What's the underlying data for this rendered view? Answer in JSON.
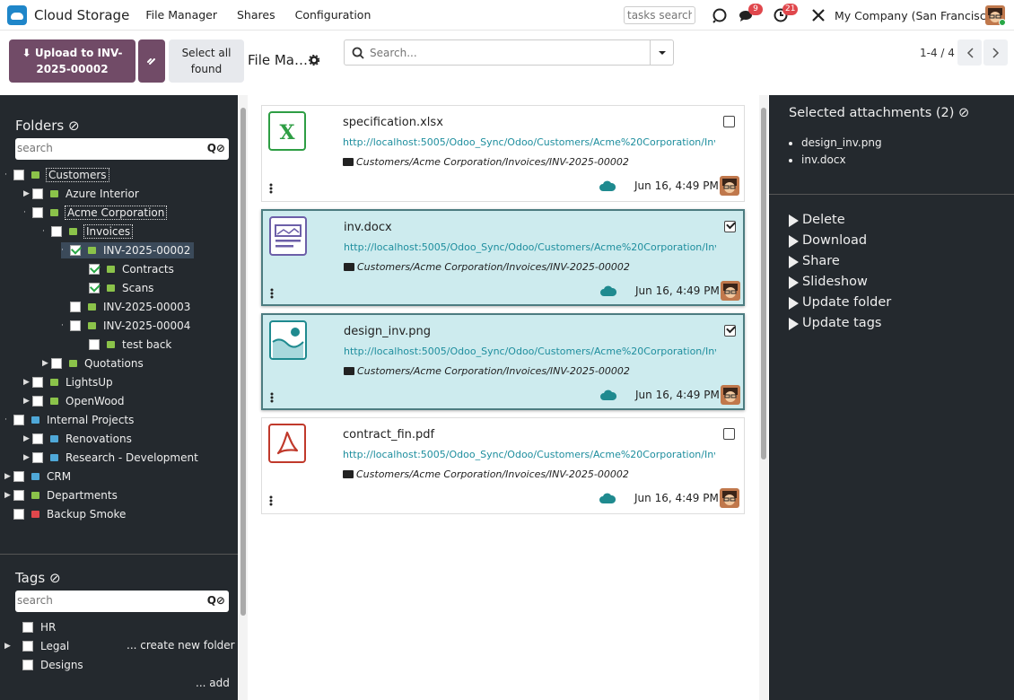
{
  "nav": {
    "brand": "Cloud Storage",
    "menu": [
      "File Manager",
      "Shares",
      "Configuration"
    ],
    "tasks_search_placeholder": "tasks search",
    "messages_badge": "9",
    "activities_badge": "21",
    "company": "My Company (San Francisco)"
  },
  "controls": {
    "upload_label": "Upload to INV-2025-00002",
    "select_all_label": "Select all found",
    "title": "File Ma…",
    "search_placeholder": "Search...",
    "pager": "1-4 / 4"
  },
  "folders": {
    "title": "Folders",
    "search_placeholder": "search",
    "search_icons": "Q⊘",
    "create_label": "... create new folder",
    "items": [
      {
        "label": "Customers"
      },
      {
        "label": "Azure Interior"
      },
      {
        "label": "Acme Corporation"
      },
      {
        "label": "Invoices"
      },
      {
        "label": "INV-2025-00002"
      },
      {
        "label": "Contracts"
      },
      {
        "label": "Scans"
      },
      {
        "label": "INV-2025-00003"
      },
      {
        "label": "INV-2025-00004"
      },
      {
        "label": "test back"
      },
      {
        "label": "Quotations"
      },
      {
        "label": "LightsUp"
      },
      {
        "label": "OpenWood"
      },
      {
        "label": "Internal Projects"
      },
      {
        "label": "Renovations"
      },
      {
        "label": "Research - Development"
      },
      {
        "label": "CRM"
      },
      {
        "label": "Departments"
      },
      {
        "label": "Backup Smoke"
      }
    ]
  },
  "tags": {
    "title": "Tags",
    "search_placeholder": "search",
    "search_icons": "Q⊘",
    "add_label": "... add",
    "items": [
      {
        "label": "HR"
      },
      {
        "label": "Legal"
      },
      {
        "label": "Designs"
      }
    ]
  },
  "attachments": [
    {
      "name": "specification.xlsx",
      "url": "http://localhost:5005/Odoo_Sync/Odoo/Customers/Acme%20Corporation/Invoices/INV-2025-00002/specification.xlsx",
      "path": "Customers/Acme Corporation/Invoices/INV-2025-00002",
      "date": "Jun 16, 4:49 PM",
      "selected": false,
      "icon": "excel-file-icon"
    },
    {
      "name": "inv.docx",
      "url": "http://localhost:5005/Odoo_Sync/Odoo/Customers/Acme%20Corporation/Invoices/INV-2025-00002/inv.docx",
      "path": "Customers/Acme Corporation/Invoices/INV-2025-00002",
      "date": "Jun 16, 4:49 PM",
      "selected": true,
      "icon": "document-file-icon"
    },
    {
      "name": "design_inv.png",
      "url": "http://localhost:5005/Odoo_Sync/Odoo/Customers/Acme%20Corporation/Invoices/INV-2025-00002/design_inv.png",
      "path": "Customers/Acme Corporation/Invoices/INV-2025-00002",
      "date": "Jun 16, 4:49 PM",
      "selected": true,
      "icon": "image-file-icon"
    },
    {
      "name": "contract_fin.pdf",
      "url": "http://localhost:5005/Odoo_Sync/Odoo/Customers/Acme%20Corporation/Invoices/INV-2025-00002/contract_fin.pdf",
      "path": "Customers/Acme Corporation/Invoices/INV-2025-00002",
      "date": "Jun 16, 4:49 PM",
      "selected": false,
      "icon": "pdf-file-icon"
    }
  ],
  "selection": {
    "title": "Selected attachments (2)",
    "items": [
      "design_inv.png",
      "inv.docx"
    ],
    "actions": [
      "Delete",
      "Download",
      "Share",
      "Slideshow",
      "Update folder",
      "Update tags"
    ]
  },
  "colors": {
    "primary": "#714b67",
    "panel_dark": "#24292e",
    "selected_card": "#cdebee",
    "link": "#1e8e9e"
  }
}
